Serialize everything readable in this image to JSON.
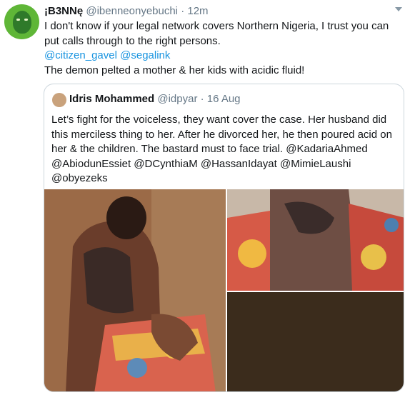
{
  "tweet": {
    "display_name": "¡B3NNę",
    "handle": "@ibenneonyebuchi",
    "separator": "·",
    "time": "12m",
    "text_line1": "I don't know if your legal network covers Northern Nigeria, I trust you can put calls through to the right persons.",
    "mention1": "@citizen_gavel",
    "mention2": "@segalink",
    "text_line3": "The demon pelted a mother & her kids with acidic fluid!"
  },
  "quoted": {
    "display_name": "Idris Mohammed",
    "handle": "@idpyar",
    "separator": "·",
    "date": "16 Aug",
    "text": "Let’s fight for the voiceless, they want cover the case. Her husband did this merciless thing to her. After he divorced her, he then poured acid on her & the children. The bastard must to face trial. @KadariaAhmed @AbiodunEssiet @DCynthiaM @HassanIdayat @MimieLaushi @obyezeks"
  },
  "colors": {
    "link": "#1b95e0",
    "secondary_text": "#657786",
    "border": "#ccd6dd"
  },
  "icons": {
    "more": "chevron-down-icon"
  }
}
